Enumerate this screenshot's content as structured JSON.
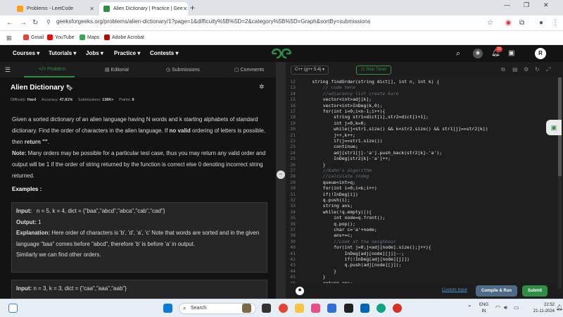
{
  "browser": {
    "tabs": [
      {
        "label": "Problems - LeetCode"
      },
      {
        "label": "Alien Dictionary | Practice | Gee"
      }
    ],
    "url": "geeksforgeeks.org/problems/alien-dictionary/1?page=1&difficulty%5B%5D=2&category%5B%5D=Graph&sortBy=submissions",
    "bookmarks": [
      {
        "label": "Gmail",
        "color": "#ea4335"
      },
      {
        "label": "YouTube",
        "color": "#ff0000"
      },
      {
        "label": "Maps",
        "color": "#34a853"
      },
      {
        "label": "Adobe Acrobat",
        "color": "#b30b00"
      }
    ]
  },
  "gfg_nav": {
    "items": [
      "Courses",
      "Tutorials",
      "Jobs",
      "Practice",
      "Contests"
    ],
    "notification_count": "20",
    "avatar": "R"
  },
  "problem_tabs": [
    "Problem",
    "Editorial",
    "Submissions",
    "Comments"
  ],
  "problem": {
    "title": "Alien Dictionary",
    "difficulty_label": "Difficulty:",
    "difficulty": "Hard",
    "accuracy_label": "Accuracy:",
    "accuracy": "47.81%",
    "submissions_label": "Submissions:",
    "submissions": "138K+",
    "points_label": "Points:",
    "points": "8",
    "desc_1": "Given a sorted dictionary of an alien language having N words and k starting alphabets of standard dictionary. Find the order of characters in the alien language. If ",
    "desc_bold1": "no valid",
    "desc_2": " ordering of letters is possible, then ",
    "desc_bold2": "return \"\"",
    "desc_3": ".",
    "note_label": "Note:",
    "note": " Many orders may be possible for a particular test case, thus you may return any valid order and output will be 1 if the order of string returned by the function is correct else 0 denoting incorrect string returned.",
    "examples_heading": "Examples :",
    "example1": {
      "input_label": "Input:",
      "input": "n = 5, k = 4, dict = {\"baa\",\"abcd\",\"abca\",\"cab\",\"cad\"}",
      "output_label": "Output:",
      "output": "1",
      "explanation_label": "Explanation:",
      "explanation": "Here order of characters is 'b', 'd', 'a', 'c' Note that words are sorted and in the given language \"baa\" comes before \"abcd\", therefore 'b' is before 'a' in output.",
      "extra": "Similarly we can find other orders."
    },
    "example2": {
      "input_label": "Input:",
      "input": "n = 3, k = 3, dict = {\"caa\",\"aaa\",\"aab\"}"
    }
  },
  "editor": {
    "language": "C++ (g++ 5.4)",
    "start_timer": "Start Timer",
    "lines": [
      {
        "n": "12",
        "t": "    string findOrder(string dict[], int n, int k) {",
        "c": ""
      },
      {
        "n": "13",
        "t": "        // code here",
        "c": "cm"
      },
      {
        "n": "14",
        "t": "        //adjacency list create karo",
        "c": "cm"
      },
      {
        "n": "15",
        "t": "        vector<int>adj[k];",
        "c": ""
      },
      {
        "n": "16",
        "t": "        vector<int>InDeg(k,0);",
        "c": ""
      },
      {
        "n": "17",
        "t": "        for(int i=0;i<n-1;i++){",
        "c": ""
      },
      {
        "n": "18",
        "t": "            string str1=dict[i],str2=dict[i+1];",
        "c": ""
      },
      {
        "n": "19",
        "t": "            int j=0,k=0;",
        "c": ""
      },
      {
        "n": "20",
        "t": "            while(j<str1.size() && k<str2.size() && str1[j]==str2[k])",
        "c": ""
      },
      {
        "n": "21",
        "t": "            j++,k++;",
        "c": ""
      },
      {
        "n": "22",
        "t": "            if(j==str1.size())",
        "c": ""
      },
      {
        "n": "23",
        "t": "            continue;",
        "c": ""
      },
      {
        "n": "24",
        "t": "            adj[str1[j]-'a'].push_back(str2[k]-'a');",
        "c": ""
      },
      {
        "n": "25",
        "t": "            InDeg[str2[k]-'a']++;",
        "c": ""
      },
      {
        "n": "26",
        "t": "        }",
        "c": ""
      },
      {
        "n": "27",
        "t": "        //Kahn's algorithm",
        "c": "cm"
      },
      {
        "n": "28",
        "t": "        //calculate indeg",
        "c": "cm"
      },
      {
        "n": "29",
        "t": "        queue<int>q;",
        "c": ""
      },
      {
        "n": "30",
        "t": "        for(int i=0;i<k;i++)",
        "c": ""
      },
      {
        "n": "31",
        "t": "        if(!InDeg[i])",
        "c": ""
      },
      {
        "n": "32",
        "t": "        q.push(i);",
        "c": ""
      },
      {
        "n": "33",
        "t": "        string ans;",
        "c": ""
      },
      {
        "n": "34",
        "t": "        while(!q.empty()){",
        "c": ""
      },
      {
        "n": "35",
        "t": "            int node=q.front();",
        "c": ""
      },
      {
        "n": "36",
        "t": "            q.pop();",
        "c": ""
      },
      {
        "n": "37",
        "t": "            char c='a'+node;",
        "c": ""
      },
      {
        "n": "38",
        "t": "            ans+=c;",
        "c": ""
      },
      {
        "n": "39",
        "t": "            //Look at the neighbour",
        "c": "cm"
      },
      {
        "n": "40",
        "t": "            for(int j=0;j<adj[node].size();j++){",
        "c": ""
      },
      {
        "n": "41",
        "t": "                InDeg[adj[node][j]]--;",
        "c": ""
      },
      {
        "n": "42",
        "t": "                if(!InDeg[adj[node][j]])",
        "c": ""
      },
      {
        "n": "43",
        "t": "                q.push(adj[node][j]);",
        "c": ""
      },
      {
        "n": "44",
        "t": "            }",
        "c": ""
      },
      {
        "n": "45",
        "t": "        }",
        "c": ""
      },
      {
        "n": "46",
        "t": "        return ans;",
        "c": ""
      }
    ],
    "custom_input": "Custom Input",
    "compile_run": "Compile & Run",
    "submit": "Submit"
  },
  "taskbar": {
    "search": "Search",
    "lang_top": "ENG",
    "lang_bottom": "IN",
    "time": "22:52",
    "date": "21-11-2024"
  }
}
